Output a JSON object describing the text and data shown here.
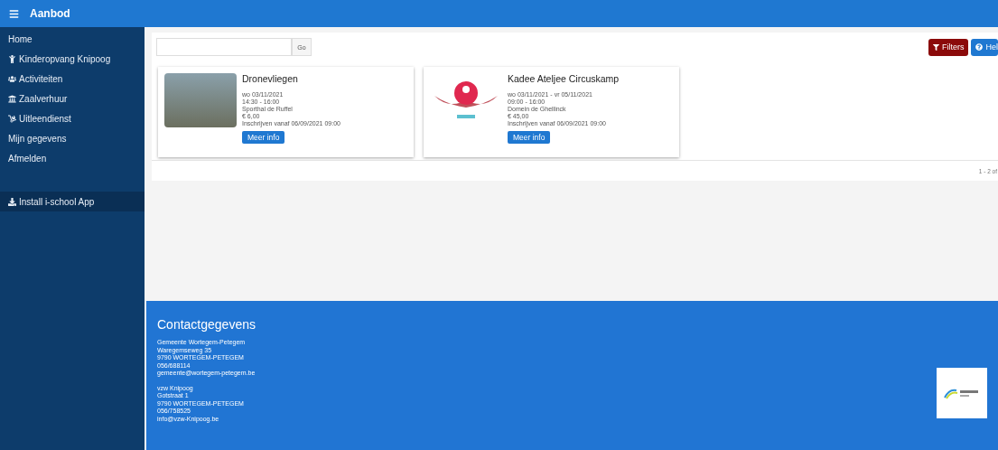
{
  "header": {
    "title": "Aanbod"
  },
  "sidebar": {
    "items": [
      {
        "label": "Home",
        "selected": false
      },
      {
        "label": "Kinderopvang Knipoog",
        "selected": false
      },
      {
        "label": "Activiteiten",
        "selected": false
      },
      {
        "label": "Zaalverhuur",
        "selected": false
      },
      {
        "label": "Uitleendienst",
        "selected": false
      },
      {
        "label": "Mijn gegevens",
        "selected": false
      },
      {
        "label": "Afmelden",
        "selected": false
      },
      {
        "label": "Install i-school App",
        "selected": true
      }
    ]
  },
  "search": {
    "button": "Go"
  },
  "toolbar": {
    "filters": "Filters",
    "help": "Hel"
  },
  "cards": [
    {
      "title": "Dronevliegen",
      "lines": [
        "wo 03/11/2021",
        "14:30 - 16:00",
        "Sporthal de Ruffel",
        "€ 6,00",
        "Inschrijven vanaf 06/09/2021 09:00"
      ],
      "button": "Meer info"
    },
    {
      "title": "Kadee Ateljee Circuskamp",
      "lines": [
        "wo 03/11/2021 - vr 05/11/2021",
        "09:00 - 16:00",
        "Domein de Ghellinck",
        "€ 45,00",
        "Inschrijven vanaf 06/09/2021 09:00"
      ],
      "button": "Meer info"
    }
  ],
  "pagination": "1 - 2 of",
  "footer": {
    "title": "Contactgegevens",
    "blocks": [
      [
        "Gemeente Wortegem-Petegem",
        "Waregemseweg 35",
        "9790 WORTEGEM-PETEGEM",
        "056/688114",
        "gemeente@wortegem-petegem.be"
      ],
      [
        "vzw Knipoog",
        "Gotstraat 1",
        "9790 WORTEGEM-PETEGEM",
        "056/758525",
        "info@vzw-Knipoog.be"
      ]
    ]
  }
}
